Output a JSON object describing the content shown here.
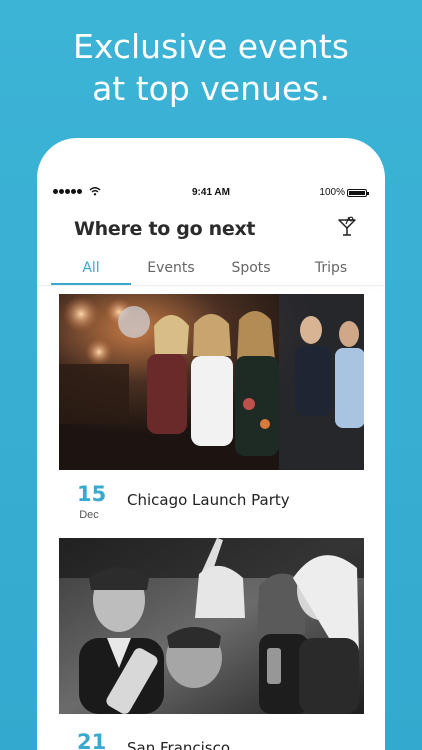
{
  "headline": {
    "line1": "Exclusive events",
    "line2": "at top venues."
  },
  "status_bar": {
    "time": "9:41 AM",
    "battery": "100%"
  },
  "header": {
    "title": "Where to go next",
    "icon": "cocktail-icon"
  },
  "tabs": [
    {
      "label": "All",
      "active": true
    },
    {
      "label": "Events",
      "active": false
    },
    {
      "label": "Spots",
      "active": false
    },
    {
      "label": "Trips",
      "active": false
    }
  ],
  "events": [
    {
      "day": "15",
      "month": "Dec",
      "name": "Chicago Launch Party"
    },
    {
      "day": "21",
      "month": "",
      "name": "San Francisco"
    }
  ],
  "colors": {
    "background": "#3cb4d6",
    "accent": "#3aa9d0",
    "text": "#2b2b2b"
  }
}
